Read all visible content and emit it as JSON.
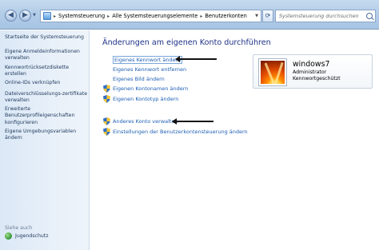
{
  "navigation": {
    "back_label": "◀",
    "forward_label": "▶",
    "breadcrumbs": [
      "Systemsteuerung",
      "Alle Systemsteuerungselemente",
      "Benutzerkonten"
    ],
    "search_placeholder": "Systemsteuerung durchsuchen"
  },
  "sidebar": {
    "items": [
      "Startseite der Systemsteuerung",
      "Eigene Anmeldeinformationen verwalten",
      "Kennwortrücksetzdiskette erstellen",
      "Online-IDs verknüpfen",
      "Dateiverschlüsselungs-zertifikate verwalten",
      "Erweiterte Benutzerprofileigenschaften konfigurieren",
      "Eigene Umgebungsvariablen ändern"
    ],
    "see_also_label": "Siehe auch",
    "see_also_items": [
      "Jugendschutz"
    ]
  },
  "main": {
    "title": "Änderungen am eigenen Konto durchführen",
    "tasks": [
      "Eigenes Kennwort ändern",
      "Eigenes Kennwort entfernen",
      "Eigenes Bild ändern",
      "Eigenen Kontonamen ändern",
      "Eigenen Kontotyp ändern",
      "Anderes Konto verwalten",
      "Einstellungen der Benutzerkontensteuerung ändern"
    ],
    "account": {
      "name": "windows7",
      "role": "Administrator",
      "password_status": "Kennwortgeschützt"
    }
  },
  "colors": {
    "link": "#1e5fb4",
    "title": "#1e3287",
    "sidebar_bg": "#dbe8f6"
  }
}
